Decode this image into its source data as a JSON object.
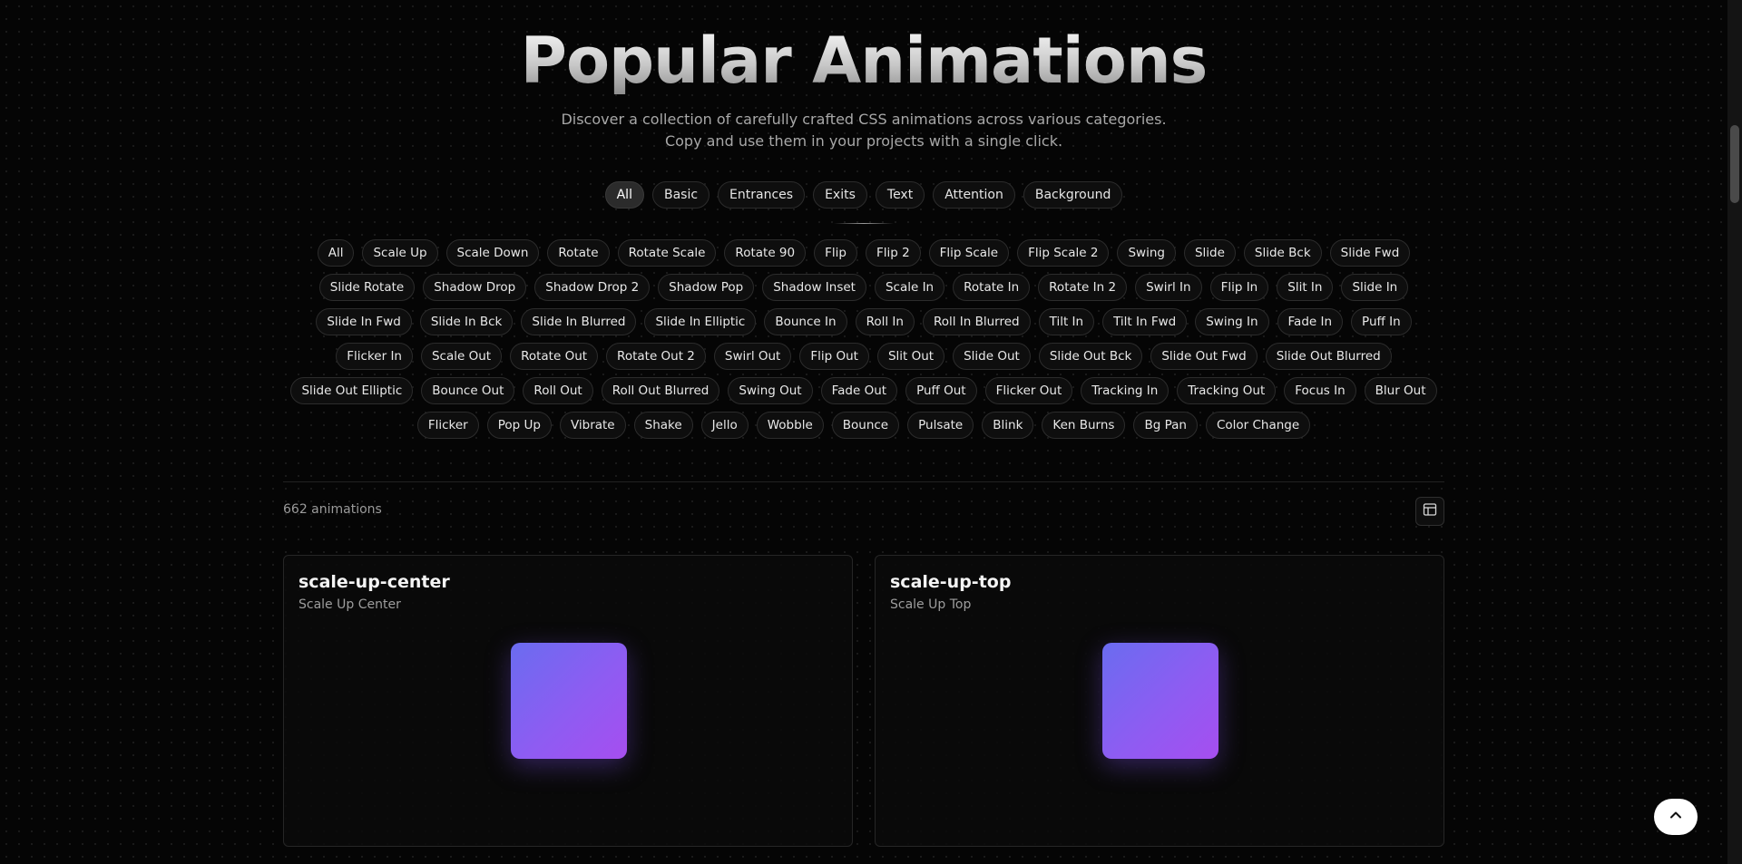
{
  "header": {
    "title": "Popular Animations",
    "subtitle": "Discover a collection of carefully crafted CSS animations across various categories. Copy and use them in your projects with a single click."
  },
  "category_tabs": [
    {
      "label": "All",
      "active": true
    },
    {
      "label": "Basic",
      "active": false
    },
    {
      "label": "Entrances",
      "active": false
    },
    {
      "label": "Exits",
      "active": false
    },
    {
      "label": "Text",
      "active": false
    },
    {
      "label": "Attention",
      "active": false
    },
    {
      "label": "Background",
      "active": false
    }
  ],
  "sub_categories": [
    "All",
    "Scale Up",
    "Scale Down",
    "Rotate",
    "Rotate Scale",
    "Rotate 90",
    "Flip",
    "Flip 2",
    "Flip Scale",
    "Flip Scale 2",
    "Swing",
    "Slide",
    "Slide Bck",
    "Slide Fwd",
    "Slide Rotate",
    "Shadow Drop",
    "Shadow Drop 2",
    "Shadow Pop",
    "Shadow Inset",
    "Scale In",
    "Rotate In",
    "Rotate In 2",
    "Swirl In",
    "Flip In",
    "Slit In",
    "Slide In",
    "Slide In Fwd",
    "Slide In Bck",
    "Slide In Blurred",
    "Slide In Elliptic",
    "Bounce In",
    "Roll In",
    "Roll In Blurred",
    "Tilt In",
    "Tilt In Fwd",
    "Swing In",
    "Fade In",
    "Puff In",
    "Flicker In",
    "Scale Out",
    "Rotate Out",
    "Rotate Out 2",
    "Swirl Out",
    "Flip Out",
    "Slit Out",
    "Slide Out",
    "Slide Out Bck",
    "Slide Out Fwd",
    "Slide Out Blurred",
    "Slide Out Elliptic",
    "Bounce Out",
    "Roll Out",
    "Roll Out Blurred",
    "Swing Out",
    "Fade Out",
    "Puff Out",
    "Flicker Out",
    "Tracking In",
    "Tracking Out",
    "Focus In",
    "Blur Out",
    "Flicker",
    "Pop Up",
    "Vibrate",
    "Shake",
    "Jello",
    "Wobble",
    "Bounce",
    "Pulsate",
    "Blink",
    "Ken Burns",
    "Bg Pan",
    "Color Change"
  ],
  "results": {
    "count_label": "662 animations",
    "layout_toggle_icon": "layout-icon"
  },
  "cards": [
    {
      "name": "scale-up-center",
      "label": "Scale Up Center"
    },
    {
      "name": "scale-up-top",
      "label": "Scale Up Top"
    }
  ],
  "colors": {
    "accent_gradient_start": "#6a6cf0",
    "accent_gradient_end": "#a64ef0",
    "background": "#050505"
  },
  "scroll_to_top_icon": "chevron-up-icon"
}
